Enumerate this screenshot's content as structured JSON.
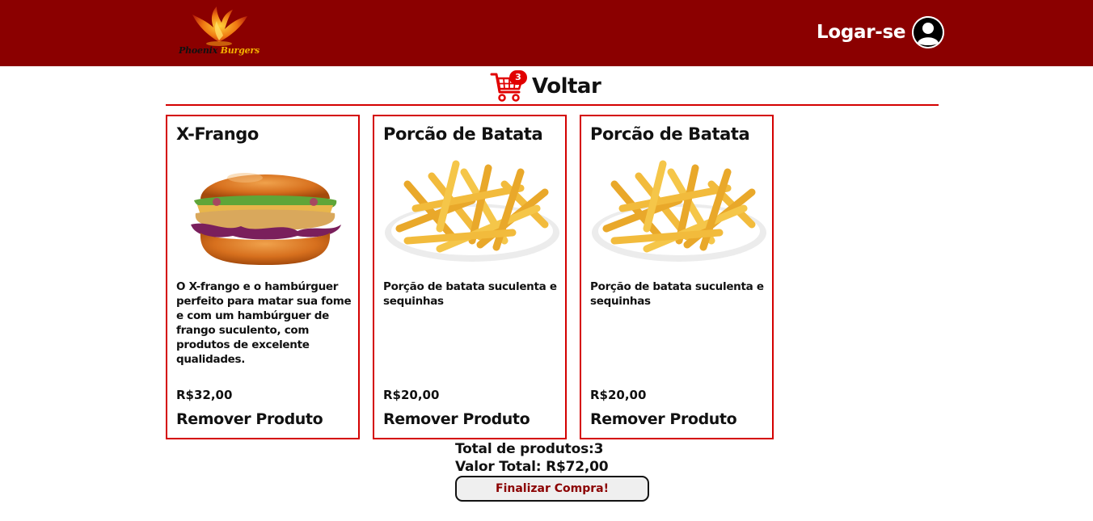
{
  "header": {
    "logo_text_1": "Phoenix",
    "logo_text_2": "Burgers",
    "login_label": "Logar-se"
  },
  "cart": {
    "count": "3",
    "back_label": "Voltar"
  },
  "products": [
    {
      "title": "X-Frango",
      "image": "burger-image",
      "description": "O X-frango e o hambúrguer perfeito para matar sua fome e com um hambúrguer de frango suculento, com produtos de excelente qualidades.",
      "price": "R$32,00",
      "remove_label": "Remover Produto"
    },
    {
      "title": "Porcão de Batata",
      "image": "fries-image",
      "description": "Porção de batata suculenta e sequinhas",
      "price": "R$20,00",
      "remove_label": "Remover Produto"
    },
    {
      "title": "Porcão de Batata",
      "image": "fries-image",
      "description": "Porção de batata suculenta e sequinhas",
      "price": "R$20,00",
      "remove_label": "Remover Produto"
    }
  ],
  "summary": {
    "total_products": "Total de produtos:3",
    "total_value": "Valor Total: R$72,00",
    "checkout_label": "Finalizar Compra!"
  },
  "colors": {
    "header_bg": "#8b0000",
    "accent_red": "#d40000",
    "badge_red": "#e10000"
  }
}
